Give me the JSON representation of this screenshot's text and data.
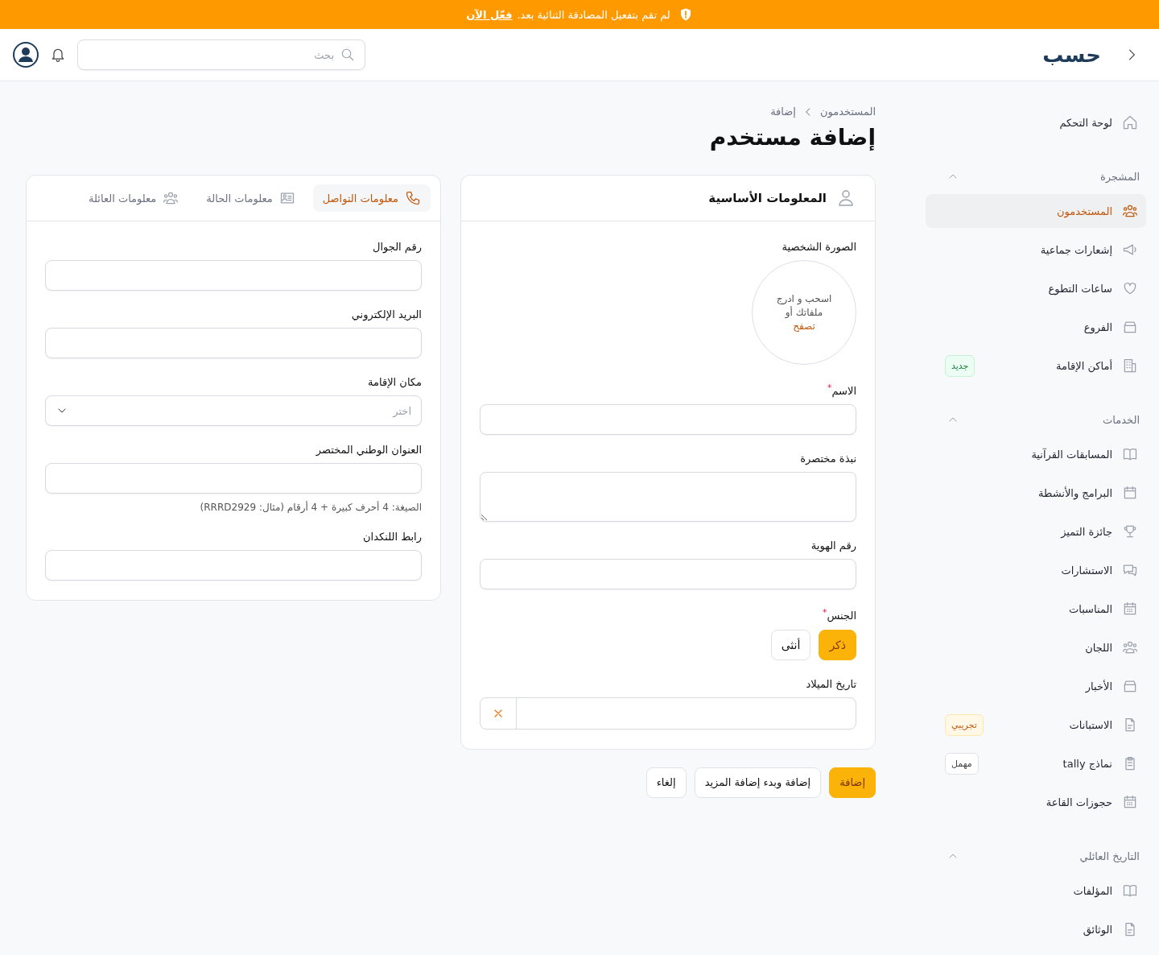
{
  "banner": {
    "message": "لم تقم بتفعيل المصادقة الثنائية بعد.",
    "link": "فعّل الآن"
  },
  "header": {
    "logo": "حسب",
    "search": {
      "placeholder": "بحث"
    }
  },
  "sidebar": {
    "sections": [
      {
        "items": [
          {
            "label": "لوحة التحكم",
            "selected": false
          }
        ]
      },
      {
        "title": "المشجرة",
        "expanded": true,
        "items": [
          {
            "label": "المستخدمون",
            "selected": true
          },
          {
            "label": "إشعارات جماعية",
            "selected": false
          },
          {
            "label": "ساعات التطوع",
            "selected": false
          },
          {
            "label": "الفروع",
            "selected": false
          },
          {
            "label": "أماكن الإقامة",
            "selected": false,
            "badge": {
              "text": "جديد",
              "kind": "new"
            }
          }
        ]
      },
      {
        "title": "الخدمات",
        "expanded": true,
        "items": [
          {
            "label": "المسابقات القرآنية",
            "selected": false
          },
          {
            "label": "البرامج والأنشطة",
            "selected": false
          },
          {
            "label": "جائزة التميز",
            "selected": false
          },
          {
            "label": "الاستشارات",
            "selected": false
          },
          {
            "label": "المناسبات",
            "selected": false
          },
          {
            "label": "اللجان",
            "selected": false
          },
          {
            "label": "الأخبار",
            "selected": false
          },
          {
            "label": "الاستبانات",
            "selected": false,
            "badge": {
              "text": "تجريبي",
              "kind": "beta"
            }
          },
          {
            "label": "نماذج tally",
            "selected": false,
            "badge": {
              "text": "مهمل",
              "kind": "deprecated"
            }
          },
          {
            "label": "حجوزات القاعة",
            "selected": false
          }
        ]
      },
      {
        "title": "التاريخ العائلي",
        "expanded": true,
        "items": [
          {
            "label": "المؤلفات",
            "selected": false
          },
          {
            "label": "الوثائق",
            "selected": false
          }
        ]
      }
    ]
  },
  "breadcrumb": [
    "المستخدمون",
    "إضافة"
  ],
  "title": "إضافة مستخدم",
  "basic_card": {
    "title": "المعلومات الأساسية",
    "photo": {
      "label": "الصورة الشخصية",
      "lines": [
        "اسحب و ادرج",
        "ملفاتك أو"
      ],
      "link": "تصفح"
    },
    "fields": [
      {
        "kind": "text",
        "label": "الاسم",
        "required_mark": "*"
      },
      {
        "kind": "textarea",
        "label": "نبذة مختصرة"
      },
      {
        "kind": "text",
        "label": "رقم الهوية"
      },
      {
        "kind": "choice",
        "label": "الجنس",
        "required_mark": "*",
        "options": [
          {
            "label": "ذكر",
            "selected": true
          },
          {
            "label": "أنثى",
            "selected": false
          }
        ]
      },
      {
        "kind": "date",
        "label": "تاريخ الميلاد"
      }
    ]
  },
  "contact_card": {
    "tabs": [
      {
        "label": "معلومات التواصل",
        "selected": true
      },
      {
        "label": "معلومات الحالة",
        "selected": false
      },
      {
        "label": "معلومات العائلة",
        "selected": false
      }
    ],
    "fields": [
      {
        "kind": "text",
        "label": "رقم الجوال"
      },
      {
        "kind": "text",
        "label": "البريد الإلكتروني"
      },
      {
        "kind": "select",
        "label": "مكان الإقامة",
        "placeholder": "اختر"
      },
      {
        "kind": "text",
        "label": "العنوان الوطني المختصر",
        "hint": "الصيغة: 4 أحرف كبيرة + 4 أرقام (مثال: RRRD2929)"
      },
      {
        "kind": "text",
        "label": "رابط اللنكدان"
      }
    ]
  },
  "actions": [
    {
      "label": "إضافة",
      "kind": "primary"
    },
    {
      "label": "إضافة وبدء إضافة المزيد",
      "kind": "secondary"
    },
    {
      "label": "إلغاء",
      "kind": "secondary"
    }
  ]
}
